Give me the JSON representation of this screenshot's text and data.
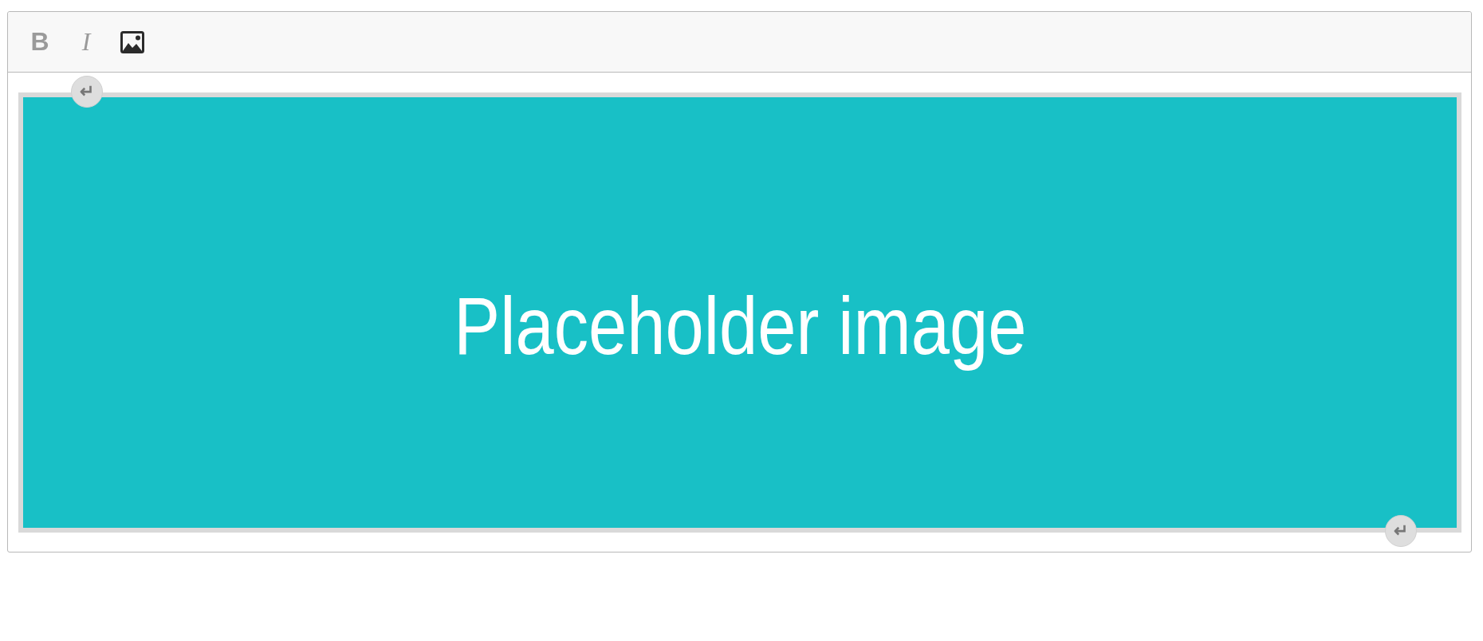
{
  "toolbar": {
    "buttons": [
      {
        "kind": "bold",
        "label": "B",
        "disabled": true
      },
      {
        "kind": "italic",
        "label": "I",
        "disabled": true
      },
      {
        "kind": "image",
        "disabled": false
      }
    ]
  },
  "image_widget": {
    "text": "Placeholder image",
    "selected": true,
    "line_buttons": [
      {
        "label": "↵"
      },
      {
        "label": "↵"
      }
    ]
  }
}
